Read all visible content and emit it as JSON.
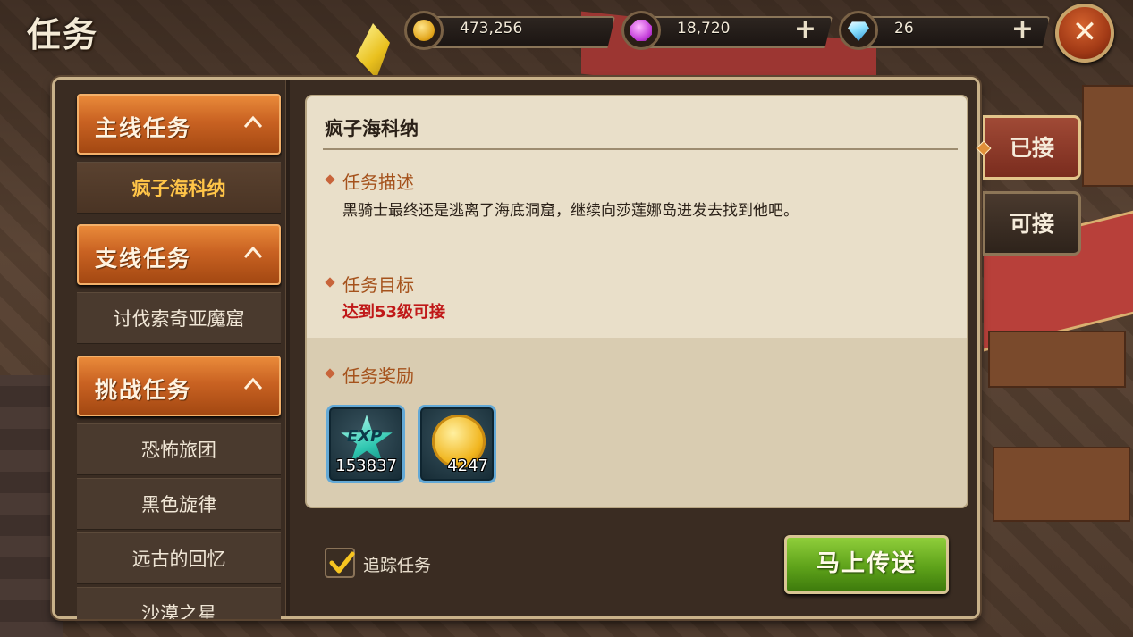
{
  "header": {
    "title": "任务",
    "resources": [
      {
        "icon": "gold-coin-icon",
        "value": "473,256",
        "has_plus": false
      },
      {
        "icon": "purple-gem-icon",
        "value": "18,720",
        "has_plus": true
      },
      {
        "icon": "diamond-icon",
        "value": "26",
        "has_plus": true
      }
    ],
    "plus_label": "+",
    "close_label": "✕"
  },
  "sidebar": {
    "categories": [
      {
        "label": "主线任务",
        "items": [
          "疯子海科纳"
        ]
      },
      {
        "label": "支线任务",
        "items": [
          "讨伐索奇亚魔窟"
        ]
      },
      {
        "label": "挑战任务",
        "items": [
          "恐怖旅团",
          "黑色旋律",
          "远古的回忆",
          "沙漠之星"
        ]
      }
    ],
    "selected": "疯子海科纳"
  },
  "quest": {
    "title": "疯子海科纳",
    "description_heading": "任务描述",
    "description": "黑骑士最终还是逃离了海底洞窟，继续向莎莲娜岛进发去找到他吧。",
    "objective_heading": "任务目标",
    "objective": "达到53级可接",
    "reward_heading": "任务奖励",
    "rewards": [
      {
        "icon": "exp-star-icon",
        "label": "EXP",
        "amount": "153837"
      },
      {
        "icon": "gold-coin-icon",
        "amount": "4247"
      }
    ]
  },
  "tabs": {
    "accepted": "已接",
    "available": "可接"
  },
  "footer": {
    "track_label": "追踪任务",
    "track_checked": true,
    "teleport_label": "马上传送"
  },
  "colors": {
    "accent_orange": "#c96222",
    "highlight_yellow": "#ffc548",
    "objective_red": "#c01818",
    "teleport_green": "#5ea21a"
  }
}
